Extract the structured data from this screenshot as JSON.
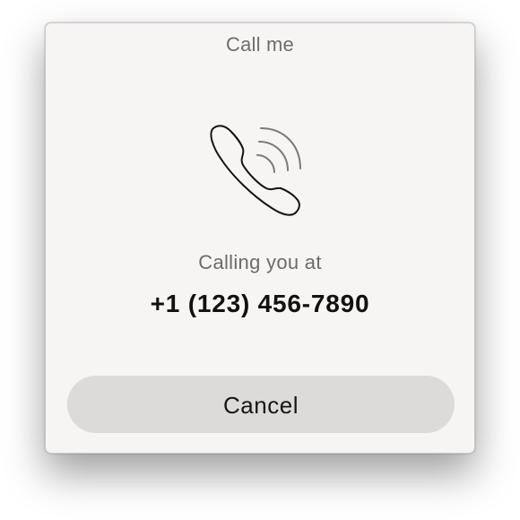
{
  "dialog": {
    "title": "Call me",
    "icon": "phone-calling-icon",
    "calling_label": "Calling you at",
    "phone_number": "+1 (123) 456-7890",
    "cancel_label": "Cancel"
  },
  "colors": {
    "dialog_background": "#f7f5f4",
    "button_background": "#dcdbda",
    "title_text": "#6e6e6e",
    "number_text": "#111111"
  }
}
